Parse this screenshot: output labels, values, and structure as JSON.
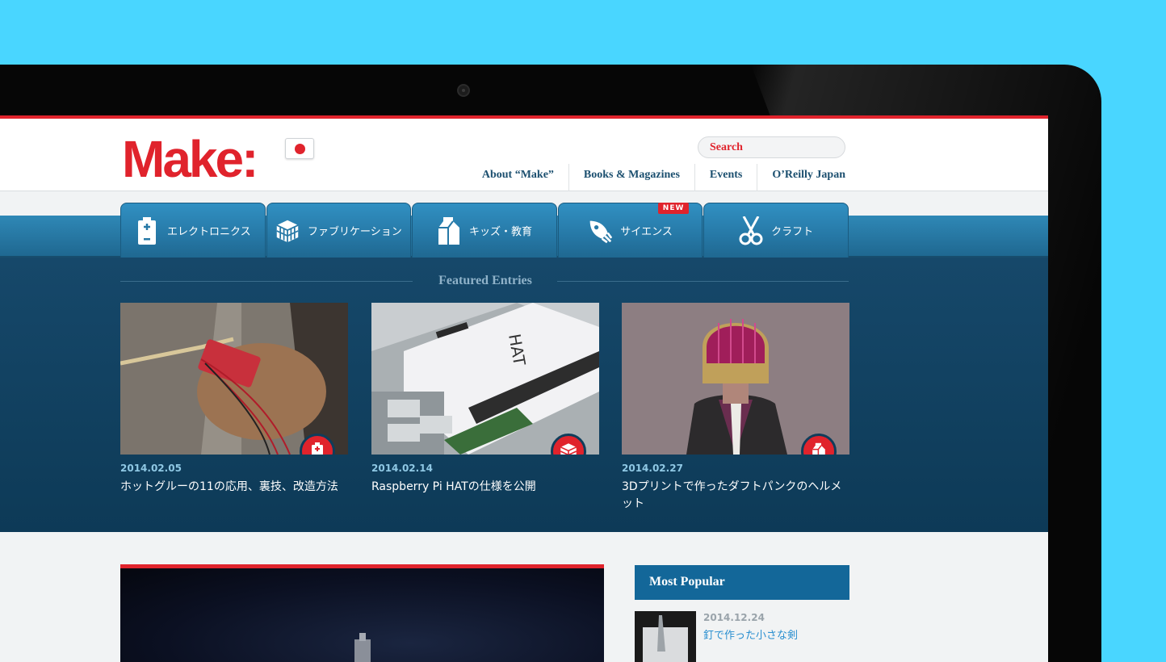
{
  "site": {
    "logo_text": "Make:",
    "flag_icon": "japan-flag-icon",
    "search_label": "Search"
  },
  "topnav": [
    {
      "label": "About “Make”"
    },
    {
      "label": "Books & Magazines"
    },
    {
      "label": "Events"
    },
    {
      "label": "O’Reilly Japan"
    }
  ],
  "tabs": [
    {
      "label": "エレクトロニクス",
      "icon": "battery-icon"
    },
    {
      "label": "ファブリケーション",
      "icon": "cube-icon"
    },
    {
      "label": "キッズ・教育",
      "icon": "milk-carton-icon"
    },
    {
      "label": "サイエンス",
      "icon": "rocket-icon",
      "badge": "NEW"
    },
    {
      "label": "クラフト",
      "icon": "scissors-icon"
    }
  ],
  "featured": {
    "title": "Featured Entries",
    "entries": [
      {
        "date": "2014.02.05",
        "title": "ホットグルーの11の応用、裏技、改造方法",
        "badge_icon": "battery-icon"
      },
      {
        "date": "2014.02.14",
        "title": "Raspberry Pi HATの仕様を公開",
        "badge_icon": "cube-icon"
      },
      {
        "date": "2014.02.27",
        "title": "3Dプリントで作ったダフトパンクのヘルメット",
        "badge_icon": "milk-carton-icon"
      }
    ],
    "image_hat_label": "HAT"
  },
  "popular": {
    "heading": "Most Popular",
    "items": [
      {
        "date": "2014.12.24",
        "title": "釘で作った小さな剣"
      }
    ]
  },
  "colors": {
    "brand_red": "#e0232c",
    "nav_blue": "#1b4f6f",
    "tab_blue": "#2678a6",
    "featured_bg": "#16486a",
    "background": "#49d6ff"
  }
}
